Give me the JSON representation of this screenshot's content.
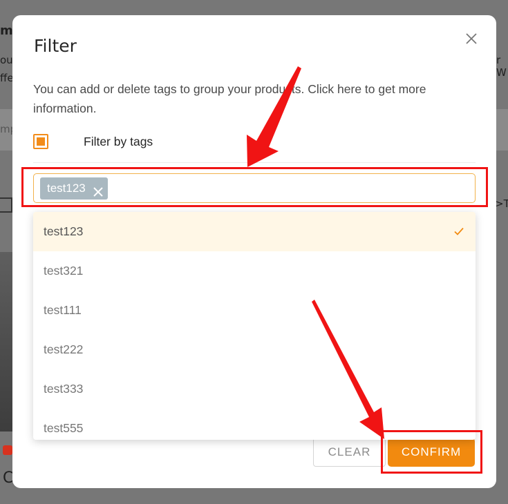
{
  "background": {
    "fragments": [
      "mp",
      "ou",
      "ffe",
      "mp",
      "r W",
      ">T",
      "C"
    ]
  },
  "modal": {
    "title": "Filter",
    "description": "You can add or delete tags to group your products. Click here to get more information.",
    "filter_label": "Filter by tags",
    "filter_checked": true,
    "selected_tags": [
      {
        "label": "test123"
      }
    ],
    "options": [
      {
        "label": "test123",
        "selected": true
      },
      {
        "label": "test321",
        "selected": false
      },
      {
        "label": "test111",
        "selected": false
      },
      {
        "label": "test222",
        "selected": false
      },
      {
        "label": "test333",
        "selected": false
      },
      {
        "label": "test555",
        "selected": false
      }
    ],
    "clear_label": "CLEAR",
    "confirm_label": "CONFIRM"
  },
  "colors": {
    "accent": "#f28a0f",
    "annotation": "#f01414",
    "chip": "#a9b8c0"
  },
  "icons": {
    "close": "close-icon",
    "chip_remove": "close-icon",
    "selected": "check-icon"
  }
}
